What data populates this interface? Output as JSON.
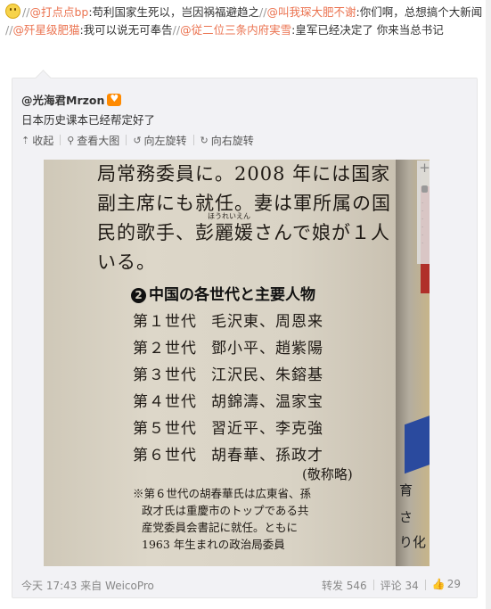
{
  "post": {
    "segments": [
      {
        "type": "slash",
        "text": "//"
      },
      {
        "type": "mention",
        "text": "@打点点bp"
      },
      {
        "type": "text",
        "text": ":苟利国家生死以，岂因祸福避趋之"
      },
      {
        "type": "slash",
        "text": "//"
      },
      {
        "type": "mention",
        "text": "@叫我琛大肥不谢"
      },
      {
        "type": "text",
        "text": ":你们啊，总想搞个大新闻 "
      },
      {
        "type": "slash",
        "text": "//"
      },
      {
        "type": "mention",
        "text": "@歼星级肥猫"
      },
      {
        "type": "text",
        "text": ":我可以说无可奉告"
      },
      {
        "type": "slash",
        "text": "//"
      },
      {
        "type": "mention",
        "text": "@従二位三条内府実雪"
      },
      {
        "type": "text",
        "text": ":皇军已经决定了 你来当总书记"
      }
    ],
    "emoji_icon": "smile-emoji-icon"
  },
  "quoted": {
    "author": "@光海君Mrzon",
    "badge_icon": "member-badge-icon",
    "text": "日本历史课本已经帮定好了",
    "toolbar": {
      "collapse": "收起",
      "view_large": "查看大图",
      "rotate_left": "向左旋转",
      "rotate_right": "向右旋转"
    }
  },
  "photo": {
    "lines": [
      "局常務委員に。2008 年には国家",
      "副主席にも就任。妻は軍所属の国",
      "民的歌手、彭麗媛さんで娘が１人",
      "いる。"
    ],
    "ruby": "ほうれいえん",
    "heading_num": "2",
    "heading": "中国の各世代と主要人物",
    "generations": [
      {
        "label": "第１世代",
        "names": "毛沢東、周恩来"
      },
      {
        "label": "第２世代",
        "names": "鄧小平、趙紫陽"
      },
      {
        "label": "第３世代",
        "names": "江沢民、朱鎔基"
      },
      {
        "label": "第４世代",
        "names": "胡錦濤、温家宝"
      },
      {
        "label": "第５世代",
        "names": "習近平、李克強"
      },
      {
        "label": "第６世代",
        "names": "胡春華、孫政才"
      }
    ],
    "honorific": "(敬称略)",
    "notes": [
      "※第６世代の胡春華氏は広東省、孫",
      "政才氏は重慶市のトップである共",
      "産党委員会書記に就任。ともに",
      "1963 年生まれの政治局委員"
    ],
    "side_texts": [
      "育",
      "さ",
      "り化"
    ]
  },
  "footer": {
    "time_source": "今天 17:43 来自 WeicoPro",
    "repost": "转发 546",
    "comment": "评论 34",
    "like": "29"
  }
}
